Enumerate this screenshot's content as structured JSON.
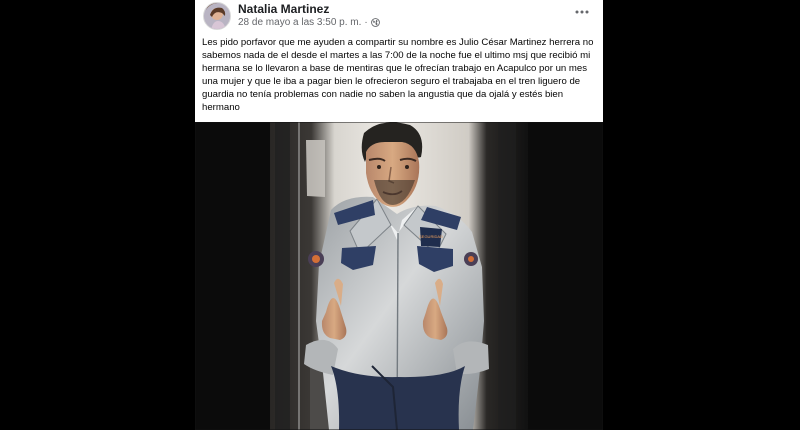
{
  "post": {
    "author": "Natalia Martinez",
    "timestamp": "28 de mayo a las 3:50 p. m.",
    "separator": "·",
    "privacy_icon": "globe-icon",
    "more_icon": "more-horizontal-icon",
    "text": "Les pido porfavor que me ayuden a compartir su nombre es Julio César Martinez herrera no sabemos nada de el desde el martes a las 7:00 de la noche fue el ultimo msj que recibió mi hermana se lo llevaron a base de mentiras que le ofrecían trabajo en Acapulco por un mes una mujer y que le iba a pagar bien le ofrecieron seguro el trabajaba en el tren liguero de guardia no tenía problemas con nadie no saben la angustia que da ojalá y estés bien hermano",
    "emoji_icons": [
      "praying-hands-icon",
      "sad-face-icon",
      "speech-bubble-icon"
    ]
  },
  "photo": {
    "patch_text": "SEGURIDAD"
  },
  "colors": {
    "card_bg": "#ffffff",
    "page_bg": "#000000",
    "text": "#050505",
    "muted": "#65676b"
  }
}
